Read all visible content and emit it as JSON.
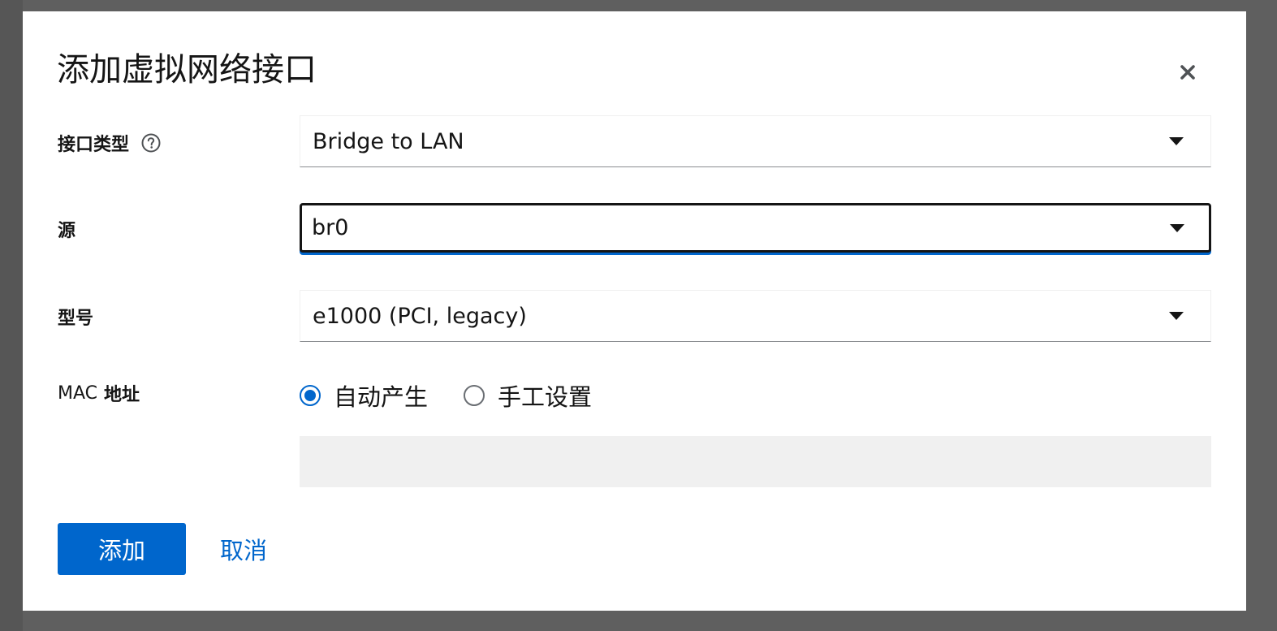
{
  "dialog": {
    "title": "添加虚拟网络接口",
    "close_icon": "close-icon"
  },
  "fields": {
    "interface_type": {
      "label": "接口类型",
      "help_icon": "help-circle-icon",
      "value": "Bridge to LAN"
    },
    "source": {
      "label": "源",
      "value": "br0"
    },
    "model": {
      "label": "型号",
      "value": "e1000 (PCI, legacy)"
    },
    "mac": {
      "label_prefix": "MAC",
      "label_suffix": "地址",
      "options": [
        {
          "label": "自动产生",
          "checked": true
        },
        {
          "label": "手工设置",
          "checked": false
        }
      ],
      "input_value": ""
    }
  },
  "footer": {
    "add_label": "添加",
    "cancel_label": "取消"
  },
  "colors": {
    "primary": "#0066cc",
    "backdrop": "#5f5f5f",
    "disabled_input": "#f0f0f0"
  }
}
